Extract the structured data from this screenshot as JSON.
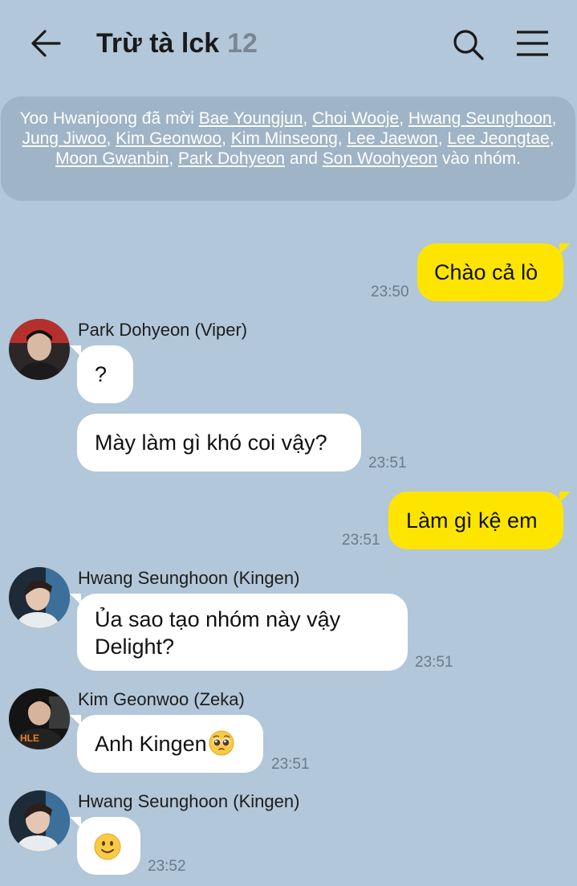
{
  "header": {
    "title": "Trừ tà lck",
    "member_count": "12",
    "back_icon": "arrow-left-icon",
    "search_icon": "search-icon",
    "menu_icon": "menu-icon"
  },
  "notice": {
    "inviter": "Yoo Hwanjoong",
    "verb": "đã mời",
    "invitees": [
      "Bae Youngjun",
      "Choi Wooje",
      "Hwang Seunghoon",
      "Jung Jiwoo",
      "Kim Geonwoo",
      "Kim Minseong",
      "Lee Jaewon",
      "Lee Jeongtae",
      "Moon Gwanbin",
      "Park Dohyeon"
    ],
    "and": "and",
    "last_invitee": "Son Woohyeon",
    "suffix": "vào nhóm."
  },
  "messages": [
    {
      "text": "Chào cả lò",
      "time": "23:50",
      "from_me": true
    },
    {
      "sender": "Park Dohyeon (Viper)",
      "text": "?",
      "time": "",
      "from_me": false
    },
    {
      "text": "Mày làm gì khó coi vậy?",
      "time": "23:51",
      "from_me": false
    },
    {
      "text": "Làm gì kệ em",
      "time": "23:51",
      "from_me": true
    },
    {
      "sender": "Hwang Seunghoon (Kingen)",
      "text_line1": "Ủa sao tạo nhóm này vậy",
      "text_line2": "Delight?",
      "time": "23:51",
      "from_me": false
    },
    {
      "sender": "Kim Geonwoo (Zeka)",
      "text": "Anh Kingen",
      "emoji": "pleading-face-emoji",
      "time": "23:51",
      "from_me": false
    },
    {
      "sender": "Hwang Seunghoon (Kingen)",
      "emoji": "slightly-smiling-face-emoji",
      "time": "23:52",
      "from_me": false
    }
  ],
  "colors": {
    "background": "#b2c7d9",
    "my_bubble": "#fee500",
    "their_bubble": "#ffffff",
    "notice_bg": "#9fb4c6"
  }
}
